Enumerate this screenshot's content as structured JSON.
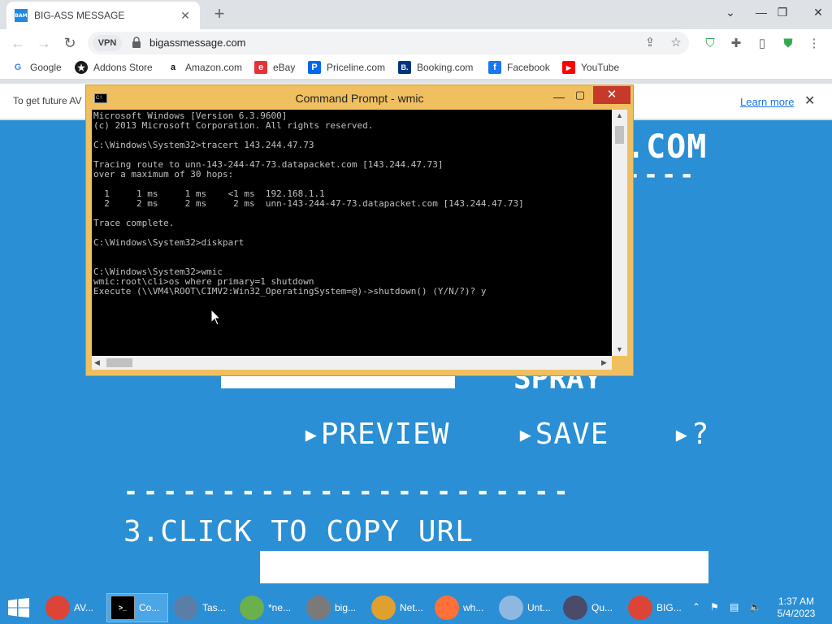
{
  "browser": {
    "tab_title": "BIG-ASS MESSAGE",
    "tab_favicon_text": "BAM",
    "newtab_icon": "+",
    "vpn_label": "VPN",
    "url": "bigassmessage.com",
    "bookmarks": [
      {
        "label": "Google",
        "icon": "google-icon",
        "color": "#4285f4",
        "glyph": "G"
      },
      {
        "label": "Addons Store",
        "icon": "addons-store-icon",
        "color": "#1a1a1a",
        "glyph": "★"
      },
      {
        "label": "Amazon.com",
        "icon": "amazon-icon",
        "color": "#ffffff",
        "glyph": "a"
      },
      {
        "label": "eBay",
        "icon": "ebay-icon",
        "color": "#e53238",
        "glyph": "e"
      },
      {
        "label": "Priceline.com",
        "icon": "priceline-icon",
        "color": "#0068ef",
        "glyph": "P"
      },
      {
        "label": "Booking.com",
        "icon": "booking-icon",
        "color": "#003580",
        "glyph": "B."
      },
      {
        "label": "Facebook",
        "icon": "facebook-icon",
        "color": "#1877f2",
        "glyph": "f"
      },
      {
        "label": "YouTube",
        "icon": "youtube-icon",
        "color": "#ff0000",
        "glyph": "▶"
      }
    ],
    "infobar_text": "To get future AV",
    "infobar_link": "Learn more"
  },
  "page": {
    "com_text": ".COM",
    "dash_top": "----",
    "spray_text": "SPRAY",
    "preview_label": "PREVIEW",
    "save_label": "SAVE",
    "help_label": "?",
    "dash_line": "-----------------------",
    "step3_label": "3.CLICK TO COPY URL"
  },
  "cmd": {
    "title": "Command Prompt - wmic",
    "icon_text": "C:\\",
    "lines": [
      "Microsoft Windows [Version 6.3.9600]",
      "(c) 2013 Microsoft Corporation. All rights reserved.",
      "",
      "C:\\Windows\\System32>tracert 143.244.47.73",
      "",
      "Tracing route to unn-143-244-47-73.datapacket.com [143.244.47.73]",
      "over a maximum of 30 hops:",
      "",
      "  1     1 ms     1 ms    <1 ms  192.168.1.1",
      "  2     2 ms     2 ms     2 ms  unn-143-244-47-73.datapacket.com [143.244.47.73]",
      "",
      "Trace complete.",
      "",
      "C:\\Windows\\System32>diskpart",
      "",
      "",
      "C:\\Windows\\System32>wmic",
      "wmic:root\\cli>os where primary=1 shutdown",
      "Execute (\\\\VM4\\ROOT\\CIMV2:Win32_OperatingSystem=@)->shutdown() (Y/N/?)? y"
    ]
  },
  "taskbar": {
    "items": [
      {
        "label": "AV...",
        "icon": "chrome-icon",
        "color": "#db4437",
        "active": false
      },
      {
        "label": "Co...",
        "icon": "cmd-icon",
        "color": "#000000",
        "active": true
      },
      {
        "label": "Tas...",
        "icon": "task-manager-icon",
        "color": "#5a7ea8",
        "active": false
      },
      {
        "label": "*ne...",
        "icon": "notepad-plus-icon",
        "color": "#6ab04c",
        "active": false
      },
      {
        "label": "big...",
        "icon": "media-icon",
        "color": "#7a7a7a",
        "active": false
      },
      {
        "label": "Net...",
        "icon": "network-icon",
        "color": "#e0a030",
        "active": false
      },
      {
        "label": "wh...",
        "icon": "firefox-icon",
        "color": "#ff7139",
        "active": false
      },
      {
        "label": "Unt...",
        "icon": "paint-icon",
        "color": "#8fb8e0",
        "active": false
      },
      {
        "label": "Qu...",
        "icon": "quick-icon",
        "color": "#4a4a6a",
        "active": false
      },
      {
        "label": "BIG...",
        "icon": "chrome-vpn-icon",
        "color": "#db4437",
        "active": false
      }
    ],
    "time": "1:37 AM",
    "date": "5/4/2023"
  }
}
